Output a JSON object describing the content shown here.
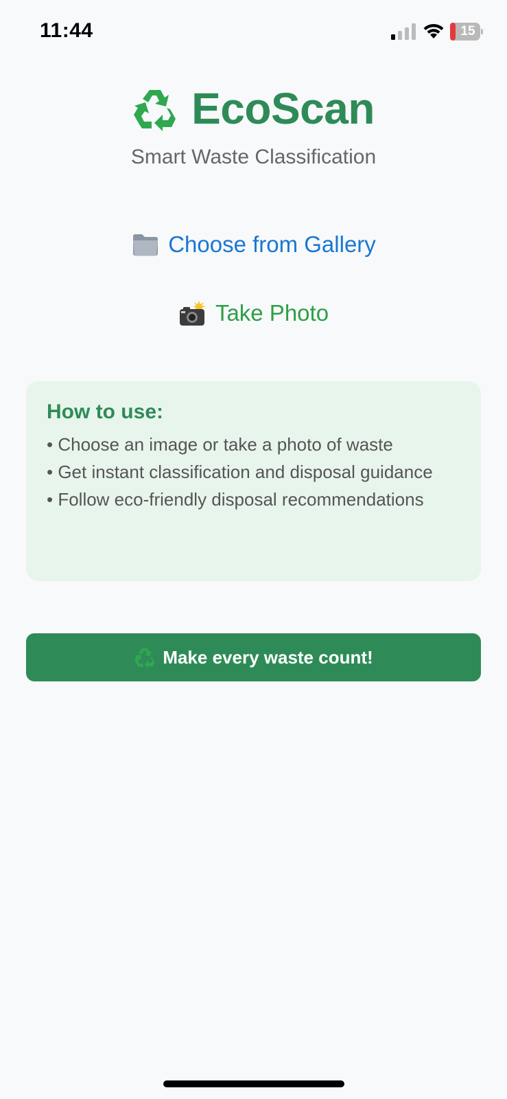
{
  "status_bar": {
    "time": "11:44",
    "battery_level": "15",
    "icons": [
      "signal-icon",
      "wifi-icon",
      "battery-icon"
    ]
  },
  "header": {
    "logo_icon": "recycle-icon",
    "title": "EcoScan",
    "subtitle": "Smart Waste Classification"
  },
  "actions": {
    "gallery": {
      "icon": "folder-icon",
      "label": "Choose from Gallery",
      "color": "#1976d2"
    },
    "photo": {
      "icon": "camera-flash-icon",
      "label": "Take Photo",
      "color": "#2e9e45"
    }
  },
  "how_to": {
    "title": "How to use:",
    "items": [
      "• Choose an image or take a photo of waste",
      "• Get instant classification and disposal guidance",
      "• Follow eco-friendly disposal recommendations"
    ]
  },
  "motto": {
    "icon": "recycle-icon",
    "text": "Make every waste count!"
  },
  "colors": {
    "brand_green": "#2e8b57",
    "card_background": "#e8f5ec",
    "page_background": "#f7f9fb"
  }
}
